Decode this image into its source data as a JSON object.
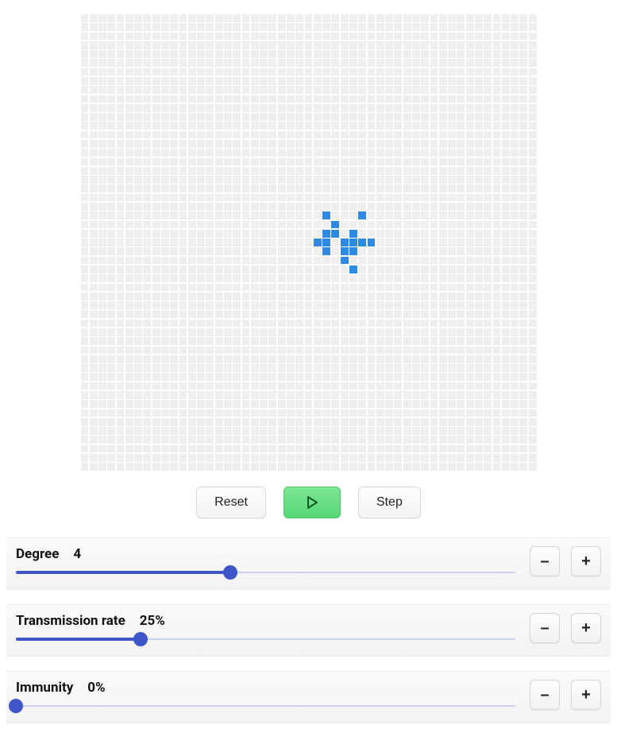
{
  "grid": {
    "size": 51,
    "active_cells": [
      [
        22,
        27
      ],
      [
        22,
        31
      ],
      [
        23,
        28
      ],
      [
        24,
        27
      ],
      [
        24,
        28
      ],
      [
        24,
        30
      ],
      [
        25,
        26
      ],
      [
        25,
        27
      ],
      [
        25,
        29
      ],
      [
        25,
        30
      ],
      [
        25,
        31
      ],
      [
        25,
        32
      ],
      [
        26,
        27
      ],
      [
        26,
        29
      ],
      [
        26,
        30
      ],
      [
        27,
        29
      ],
      [
        28,
        30
      ]
    ]
  },
  "controls": {
    "reset_label": "Reset",
    "step_label": "Step"
  },
  "params": [
    {
      "key": "degree",
      "label": "Degree",
      "value_text": "4",
      "percent": 43,
      "decrement": "–",
      "increment": "+"
    },
    {
      "key": "transmission",
      "label": "Transmission rate",
      "value_text": "25%",
      "percent": 25,
      "decrement": "–",
      "increment": "+"
    },
    {
      "key": "immunity",
      "label": "Immunity",
      "value_text": "0%",
      "percent": 0,
      "decrement": "–",
      "increment": "+"
    }
  ],
  "colors": {
    "cell_off": "#eeeeee",
    "cell_on": "#2f8ae3",
    "slider": "#3f56c8",
    "play": "#56d877"
  }
}
